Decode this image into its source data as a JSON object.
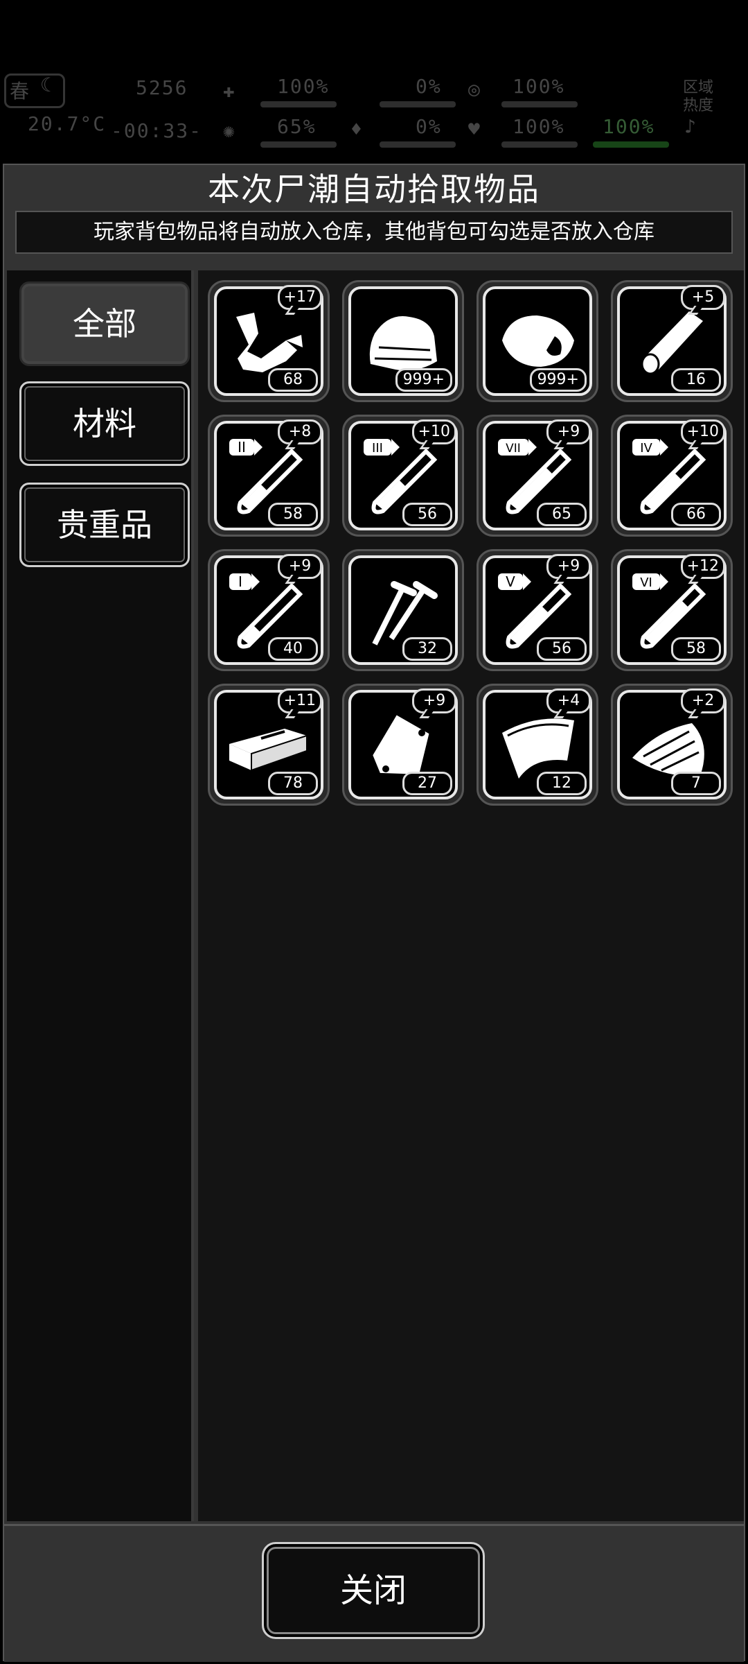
{
  "hud": {
    "season": "春",
    "coins": "5256",
    "temperature": "20.7°C",
    "clock": "-00:33-",
    "stats": [
      "100%",
      "0%",
      "100%",
      "65%",
      "0%",
      "100%",
      "100%"
    ],
    "zone_label": "区域热度"
  },
  "dialog": {
    "title": "本次尸潮自动拾取物品",
    "subtitle": "玩家背包物品将自动放入仓库，其他背包可勾选是否放入仓库"
  },
  "tabs": [
    {
      "label": "全部",
      "active": true
    },
    {
      "label": "材料",
      "active": false
    },
    {
      "label": "贵重品",
      "active": false
    }
  ],
  "items": [
    {
      "icon": "scrap-parts-icon",
      "bonus": "+17",
      "count": "68"
    },
    {
      "icon": "cloth-icon",
      "bonus": "",
      "count": "999+"
    },
    {
      "icon": "meat-icon",
      "bonus": "",
      "count": "999+"
    },
    {
      "icon": "wood-log-icon",
      "bonus": "+5",
      "count": "16"
    },
    {
      "icon": "test-tube-II-icon",
      "roman": "II",
      "bonus": "+8",
      "count": "58"
    },
    {
      "icon": "test-tube-III-icon",
      "roman": "III",
      "bonus": "+10",
      "count": "56"
    },
    {
      "icon": "test-tube-VII-icon",
      "roman": "VII",
      "bonus": "+9",
      "count": "65"
    },
    {
      "icon": "test-tube-IV-icon",
      "roman": "IV",
      "bonus": "+10",
      "count": "66"
    },
    {
      "icon": "test-tube-I-icon",
      "roman": "I",
      "bonus": "+9",
      "count": "40"
    },
    {
      "icon": "nails-icon",
      "bonus": "",
      "count": "32"
    },
    {
      "icon": "test-tube-V-icon",
      "roman": "V",
      "bonus": "+9",
      "count": "56"
    },
    {
      "icon": "test-tube-VI-icon",
      "roman": "VI",
      "bonus": "+12",
      "count": "58"
    },
    {
      "icon": "brick-icon",
      "bonus": "+11",
      "count": "78"
    },
    {
      "icon": "blood-bag-icon",
      "bonus": "+9",
      "count": "27"
    },
    {
      "icon": "leather-sheet-icon",
      "bonus": "+4",
      "count": "12"
    },
    {
      "icon": "bark-icon",
      "bonus": "+2",
      "count": "7"
    }
  ],
  "footer": {
    "close_label": "关闭"
  }
}
